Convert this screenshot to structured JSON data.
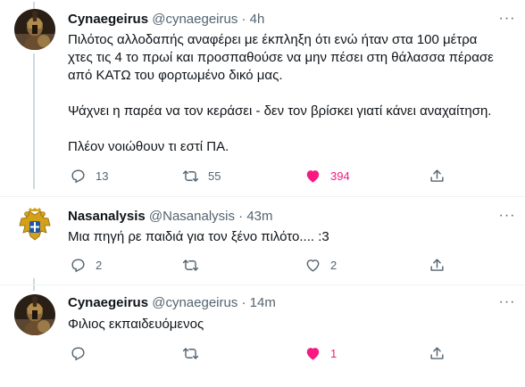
{
  "tweets": [
    {
      "name": "Cynaegeirus",
      "handle": "@cynaegeirus",
      "dot": "·",
      "time": "4h",
      "text": "Πιλότος αλλοδαπής αναφέρει με έκπληξη ότι ενώ ήταν στα 100 μέτρα\nχτες τις 4 το πρωί και προσπαθούσε να μην πέσει στη θάλασσα πέρασε\nαπό ΚΑΤΩ του φορτωμένο δικό μας.\n\nΨάχνει η παρέα να τον κεράσει - δεν τον βρίσκει γιατί κάνει αναχαίτηση.\n\nΠλέον νοιώθουν τι εστί ΠΑ.",
      "replies": "13",
      "retweets": "55",
      "likes": "394",
      "liked": true,
      "avatar_icon": "spartan-warrior-avatar-icon"
    },
    {
      "name": "Nasanalysis",
      "handle": "@Nasanalysis",
      "dot": "·",
      "time": "43m",
      "text": "Μια πηγή ρε παιδιά για τον ξένο πιλότο.... :3",
      "replies": "2",
      "retweets": "",
      "likes": "2",
      "liked": false,
      "avatar_icon": "double-headed-eagle-avatar-icon"
    },
    {
      "name": "Cynaegeirus",
      "handle": "@cynaegeirus",
      "dot": "·",
      "time": "14m",
      "text": "Φιλιος εκπαιδευόμενος",
      "replies": "",
      "retweets": "",
      "likes": "1",
      "liked": true,
      "avatar_icon": "spartan-warrior-avatar-icon"
    }
  ],
  "more_glyph": "···",
  "colors": {
    "text": "#0f1419",
    "secondary": "#536471",
    "like": "#f91880",
    "thread_line": "#cfd9de",
    "divider": "#eff3f4"
  }
}
